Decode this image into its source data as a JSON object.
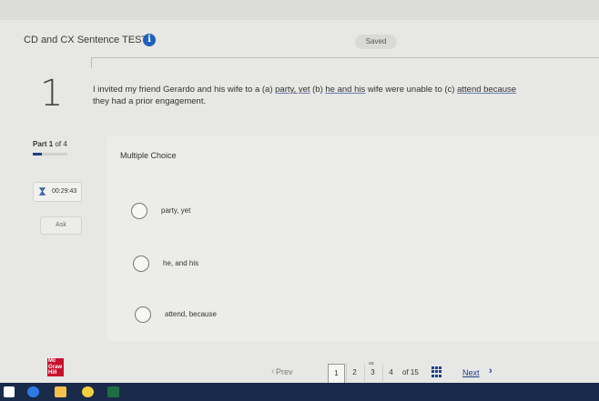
{
  "header": {
    "title": "CD and CX Sentence TEST",
    "info_icon": "info-icon",
    "saved_label": "Saved"
  },
  "question": {
    "number": "1",
    "text_parts": {
      "p1": "I invited my friend Gerardo and his wife to a (a) ",
      "a": "party, yet",
      "p2": " (b) ",
      "b": "he and his",
      "p3": " wife were unable to (c) ",
      "c": "attend because",
      "p4": " they had a prior engagement."
    }
  },
  "part": {
    "label": "Part",
    "current": "1",
    "of_text": "of 4",
    "progress_fraction": 0.25
  },
  "question_type": "Multiple Choice",
  "timer": {
    "value": "00:29:43",
    "icon": "hourglass-icon"
  },
  "ask_label": "Ask",
  "options": [
    {
      "label": "party, yet"
    },
    {
      "label": "he, and his"
    },
    {
      "label": "attend, because"
    }
  ],
  "footer": {
    "logo_lines": [
      "Mc",
      "Graw",
      "Hill"
    ],
    "prev_label": "Prev",
    "pages": [
      "1",
      "2",
      "3",
      "4"
    ],
    "current_page": "1",
    "of_text": "of 15",
    "next_label": "Next"
  },
  "colors": {
    "accent": "#1f3f8a",
    "info_blue": "#1f5fbf",
    "brand_red": "#c8102e"
  }
}
